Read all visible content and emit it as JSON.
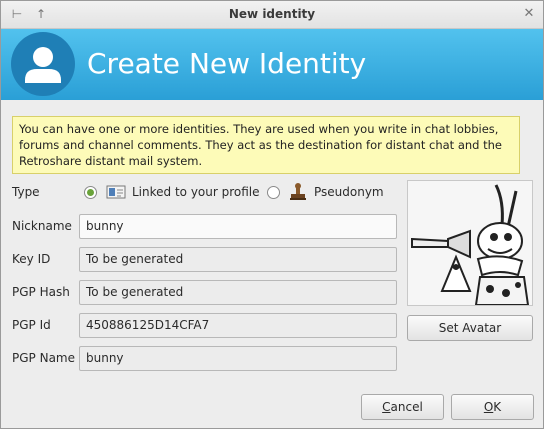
{
  "window": {
    "title": "New identity"
  },
  "header": {
    "title": "Create New Identity"
  },
  "info": {
    "text": "You can have one or more identities. They are used when you write in chat lobbies, forums and channel comments. They act as the destination for distant chat and the Retroshare distant mail system."
  },
  "type": {
    "label": "Type",
    "options": [
      {
        "label": "Linked to your profile",
        "selected": true,
        "icon": "profile-card-icon"
      },
      {
        "label": "Pseudonym",
        "selected": false,
        "icon": "pseudonym-stamp-icon"
      }
    ]
  },
  "fields": {
    "nickname": {
      "label": "Nickname",
      "value": "bunny"
    },
    "key_id": {
      "label": "Key ID",
      "value": "To be generated"
    },
    "pgp_hash": {
      "label": "PGP Hash",
      "value": "To be generated"
    },
    "pgp_id": {
      "label": "PGP Id",
      "value": "450886125D14CFA7"
    },
    "pgp_name": {
      "label": "PGP Name",
      "value": "bunny"
    }
  },
  "avatar": {
    "button_label": "Set Avatar"
  },
  "buttons": {
    "cancel_first": "C",
    "cancel_rest": "ancel",
    "ok_first": "O",
    "ok_rest": "K"
  },
  "colors": {
    "header_top": "#52c2ee",
    "header_bottom": "#2a9fd6",
    "info_bg": "#fdfbb8",
    "radio_on": "#6aa33a"
  }
}
